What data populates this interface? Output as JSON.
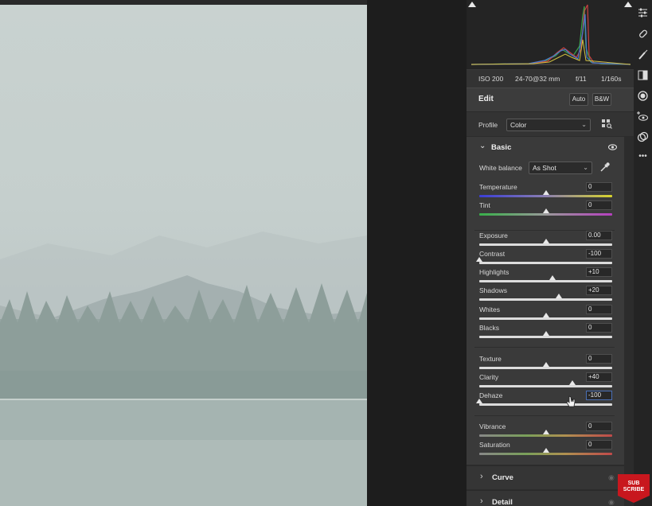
{
  "camera_info": {
    "iso": "ISO 200",
    "lens": "24-70@32 mm",
    "aperture": "f/11",
    "shutter": "1/160s"
  },
  "edit": {
    "title": "Edit",
    "auto_label": "Auto",
    "bw_label": "B&W"
  },
  "profile": {
    "label": "Profile",
    "value": "Color"
  },
  "basic": {
    "title": "Basic",
    "white_balance": {
      "label": "White balance",
      "value": "As Shot"
    },
    "sliders": [
      {
        "label": "Temperature",
        "value": "0"
      },
      {
        "label": "Tint",
        "value": "0"
      },
      {
        "label": "Exposure",
        "value": "0.00"
      },
      {
        "label": "Contrast",
        "value": "-100"
      },
      {
        "label": "Highlights",
        "value": "+10"
      },
      {
        "label": "Shadows",
        "value": "+20"
      },
      {
        "label": "Whites",
        "value": "0"
      },
      {
        "label": "Blacks",
        "value": "0"
      },
      {
        "label": "Texture",
        "value": "0"
      },
      {
        "label": "Clarity",
        "value": "+40"
      },
      {
        "label": "Dehaze",
        "value": "-100"
      },
      {
        "label": "Vibrance",
        "value": "0"
      },
      {
        "label": "Saturation",
        "value": "0"
      }
    ]
  },
  "sections": [
    {
      "title": "Curve"
    },
    {
      "title": "Detail"
    }
  ],
  "subscribe": {
    "line1": "SUB",
    "line2": "SCRIBE"
  },
  "colors": {
    "panel_bg": "#3a3a3a",
    "accent_active": "#4a6fb5",
    "subscribe_red": "#c8171e"
  },
  "icons": [
    "sliders-icon",
    "healing-icon",
    "brush-icon",
    "gradient-icon",
    "radial-icon",
    "redeye-icon",
    "presets-icon",
    "more-icon",
    "eye-icon",
    "eyedropper-icon",
    "profile-grid-icon"
  ]
}
